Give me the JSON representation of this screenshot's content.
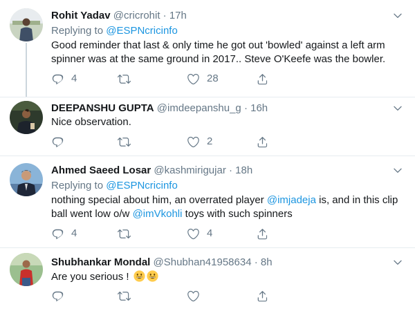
{
  "tweets": [
    {
      "name": "Rohit Yadav",
      "handle": "@cricrohit",
      "dot": "·",
      "time": "17h",
      "replying_prefix": "Replying to",
      "replying_to": "@ESPNcricinfo",
      "text_lines": [
        "Good reminder that last & only time he got out 'bowled' against a left arm",
        "spinner was at the same ground in 2017.. Steve O'Keefe was the bowler."
      ],
      "replies": "4",
      "likes": "28"
    },
    {
      "name": "DEEPANSHU GUPTA",
      "handle": "@imdeepanshu_g",
      "dot": "·",
      "time": "16h",
      "text": "Nice observation.",
      "likes": "2"
    },
    {
      "name": "Ahmed Saeed Losar",
      "handle": "@kashmirigujar",
      "dot": "·",
      "time": "18h",
      "replying_prefix": "Replying to",
      "replying_to": "@ESPNcricinfo",
      "line1_a": "nothing special about him, an overrated player ",
      "line1_mention": "@imjadeja",
      "line1_b": " is, and in this clip",
      "line2_a": "ball went low o/w ",
      "line2_mention": "@imVkohli",
      "line2_b": " toys with such spinners",
      "replies": "4",
      "likes": "4"
    },
    {
      "name": "Shubhankar Mondal",
      "handle": "@Shubhan41958634",
      "dot": "·",
      "time": "8h",
      "text": "Are you serious ! ",
      "emoji": "grinning-face-emoji"
    }
  ],
  "icons": {
    "reply": "reply-icon",
    "retweet": "retweet-icon",
    "like": "heart-icon",
    "share": "share-icon",
    "more": "chevron-down-icon"
  },
  "colors": {
    "link": "#1b95e0",
    "muted": "#657786",
    "text": "#14171a",
    "divider": "#e6ecf0",
    "thread_line": "#ccd6dd"
  }
}
